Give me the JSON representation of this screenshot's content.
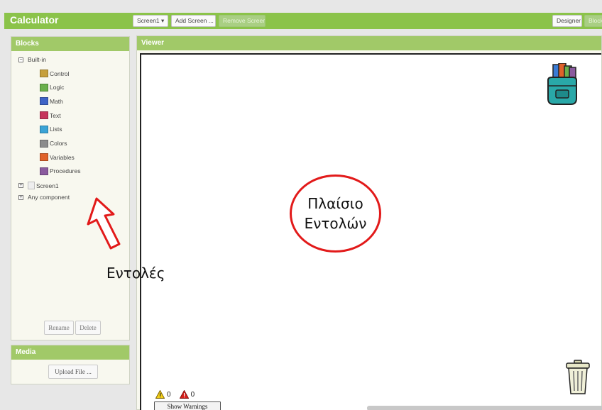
{
  "app": {
    "title": "Calculator"
  },
  "toolbar": {
    "screen_select": "Screen1 ▾",
    "add_screen": "Add Screen ...",
    "remove_screen": "Remove Screen",
    "designer": "Designer",
    "blocks": "Blocks"
  },
  "blocks_panel": {
    "title": "Blocks",
    "builtin_label": "Built-in",
    "builtin_items": [
      {
        "label": "Control",
        "color": "#c69f3b"
      },
      {
        "label": "Logic",
        "color": "#6ab04c"
      },
      {
        "label": "Math",
        "color": "#3e63c6"
      },
      {
        "label": "Text",
        "color": "#c6345b"
      },
      {
        "label": "Lists",
        "color": "#3aa3d6"
      },
      {
        "label": "Colors",
        "color": "#8c8c8c"
      },
      {
        "label": "Variables",
        "color": "#e0622a"
      },
      {
        "label": "Procedures",
        "color": "#8a5a9e"
      }
    ],
    "screen_label": "Screen1",
    "any_component_label": "Any component",
    "rename_button": "Rename",
    "delete_button": "Delete"
  },
  "media_panel": {
    "title": "Media",
    "upload_button": "Upload File ..."
  },
  "viewer": {
    "title": "Viewer",
    "warning_count": "0",
    "error_count": "0",
    "show_warnings_button": "Show Warnings"
  },
  "annotations": {
    "circle_line1": "Πλαίσιο",
    "circle_line2": "Εντολών",
    "arrow_label": "Εντολές"
  },
  "colors": {
    "accent_green": "#8bc34a",
    "panel_header": "#a1c968",
    "annotation_red": "#e21a1a"
  }
}
